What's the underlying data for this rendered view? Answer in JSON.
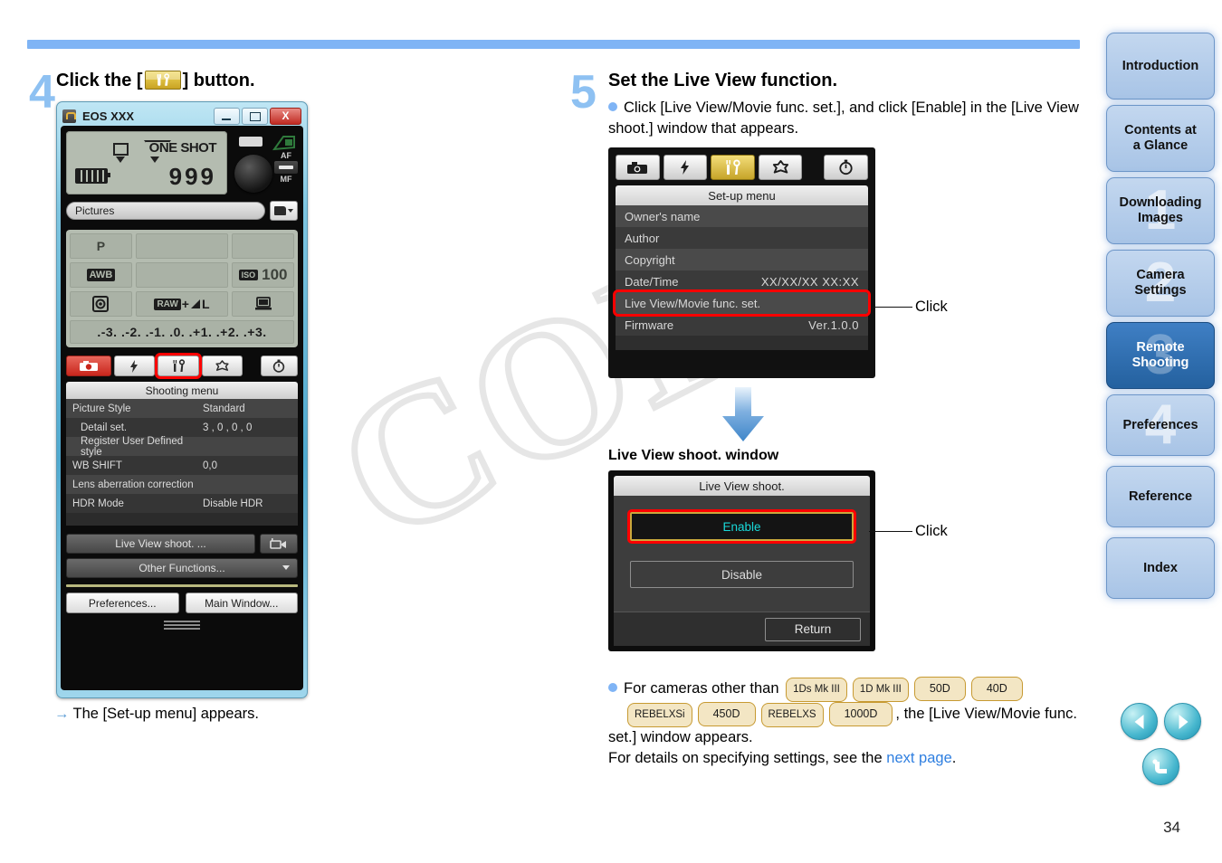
{
  "page": {
    "number": "34",
    "watermark": "COPY"
  },
  "step4": {
    "number": "4",
    "title_before": "Click the [",
    "title_after": "] button.",
    "note_arrow": "→",
    "note": "The [Set-up menu] appears.",
    "eos_window": {
      "title": "EOS XXX",
      "title_icon": "camera-lock-icon",
      "buttons": {
        "minimize": "minimize-icon",
        "maximize": "maximize-icon",
        "close": "X"
      },
      "lcd": {
        "drive_mode": "single-shot-icon",
        "metering": "evaluative-icon",
        "af_mode": "ONE SHOT",
        "shots": "999",
        "battery": "battery-icon"
      },
      "af_switch": {
        "top": "AF",
        "bottom": "MF"
      },
      "save_path": "Pictures",
      "folder_button": "folder-icon",
      "settings_grid": {
        "row1": [
          "P",
          "",
          ""
        ],
        "row2": [
          "AWB",
          "",
          "ISO 100"
        ],
        "row3": [
          "metering-icon",
          "RAW+ L",
          "pc-icon"
        ],
        "exposure_scale": ".-3. .-2. .-1. .0. .+1. .+2. .+3."
      },
      "tabs": [
        {
          "name": "shooting",
          "icon": "camera-icon",
          "selected": false,
          "accent": "#c8261c"
        },
        {
          "name": "flash",
          "icon": "flash-icon",
          "selected": false
        },
        {
          "name": "setup",
          "icon": "wrench-icon",
          "selected": true
        },
        {
          "name": "my-menu",
          "icon": "star-icon",
          "selected": false
        },
        {
          "name": "timer",
          "icon": "clock-icon",
          "selected": false
        }
      ],
      "menu_title": "Shooting menu",
      "menu_rows": [
        {
          "key": "Picture Style",
          "value": "Standard",
          "indent": false
        },
        {
          "key": "Detail set.",
          "value": "3 , 0 , 0 , 0",
          "indent": true
        },
        {
          "key": "Register User Defined style",
          "value": "",
          "indent": true
        },
        {
          "key": "WB SHIFT",
          "value": "0,0",
          "indent": false
        },
        {
          "key": "Lens aberration correction",
          "value": "",
          "indent": false
        },
        {
          "key": "HDR Mode",
          "value": "Disable HDR",
          "indent": false
        }
      ],
      "live_view_button": "Live View shoot. ...",
      "live_view_icon": "movie-camera-icon",
      "other_functions": "Other Functions...",
      "preferences": "Preferences...",
      "main_window": "Main Window..."
    }
  },
  "step5": {
    "number": "5",
    "title": "Set the Live View function.",
    "bullet1": "Click [Live View/Movie func. set.], and click [Enable] in the [Live View shoot.] window that appears.",
    "setup_menu": {
      "tabs": [
        {
          "name": "shooting",
          "icon": "camera-icon",
          "selected": false
        },
        {
          "name": "flash",
          "icon": "flash-icon",
          "selected": false
        },
        {
          "name": "setup",
          "icon": "wrench-icon",
          "selected": true
        },
        {
          "name": "my-menu",
          "icon": "star-icon",
          "selected": false
        },
        {
          "name": "timer",
          "icon": "clock-icon",
          "selected": false
        }
      ],
      "title": "Set-up menu",
      "rows": [
        {
          "key": "Owner's name",
          "value": "",
          "highlight": false
        },
        {
          "key": "Author",
          "value": "",
          "highlight": false
        },
        {
          "key": "Copyright",
          "value": "",
          "highlight": false
        },
        {
          "key": "Date/Time",
          "value": "XX/XX/XX   XX:XX",
          "highlight": false
        },
        {
          "key": "Live View/Movie func. set.",
          "value": "",
          "highlight": true
        },
        {
          "key": "Firmware",
          "value": "Ver.1.0.0",
          "highlight": false
        }
      ],
      "callout": "Click"
    },
    "lv_window_label": "Live View shoot. window",
    "lv_window": {
      "title": "Live View shoot.",
      "enable": "Enable",
      "disable": "Disable",
      "return": "Return",
      "callout": "Click"
    },
    "bullet2": {
      "text_before": "For cameras other than",
      "badges": [
        "1Ds Mk III",
        "1D Mk III",
        "50D",
        "40D",
        "REBELXSi",
        "450D",
        "REBELXS",
        "1000D"
      ],
      "text_mid": ", the [Live View/Movie func. set.] window appears.",
      "text_after": "For details on specifying settings, see the",
      "link": "next page",
      "period": "."
    }
  },
  "sidebar": {
    "items": [
      {
        "label": "Introduction",
        "watermark": "",
        "active": false
      },
      {
        "label": "Contents at\na Glance",
        "line1": "Contents at",
        "line2": "a Glance",
        "watermark": "",
        "active": false
      },
      {
        "label": "Downloading Images",
        "line1": "Downloading",
        "line2": "Images",
        "watermark": "1",
        "active": false
      },
      {
        "label": "Camera Settings",
        "line1": "Camera",
        "line2": "Settings",
        "watermark": "2",
        "active": false
      },
      {
        "label": "Remote Shooting",
        "line1": "Remote",
        "line2": "Shooting",
        "watermark": "3",
        "active": true
      },
      {
        "label": "Preferences",
        "line1": "Preferences",
        "line2": "",
        "watermark": "4",
        "active": false
      },
      {
        "label": "Reference",
        "line1": "Reference",
        "line2": "",
        "watermark": "",
        "active": false
      },
      {
        "label": "Index",
        "line1": "Index",
        "line2": "",
        "watermark": "",
        "active": false
      }
    ],
    "nav": {
      "prev": "prev-page-icon",
      "next": "next-page-icon",
      "back": "back-icon"
    }
  },
  "colors": {
    "accent_blue": "#7fb4f5",
    "highlight_red": "#ff0000",
    "active_tab_gold": "#c6a429",
    "enable_cyan": "#19d9d9",
    "link_blue": "#2f7fe0"
  }
}
